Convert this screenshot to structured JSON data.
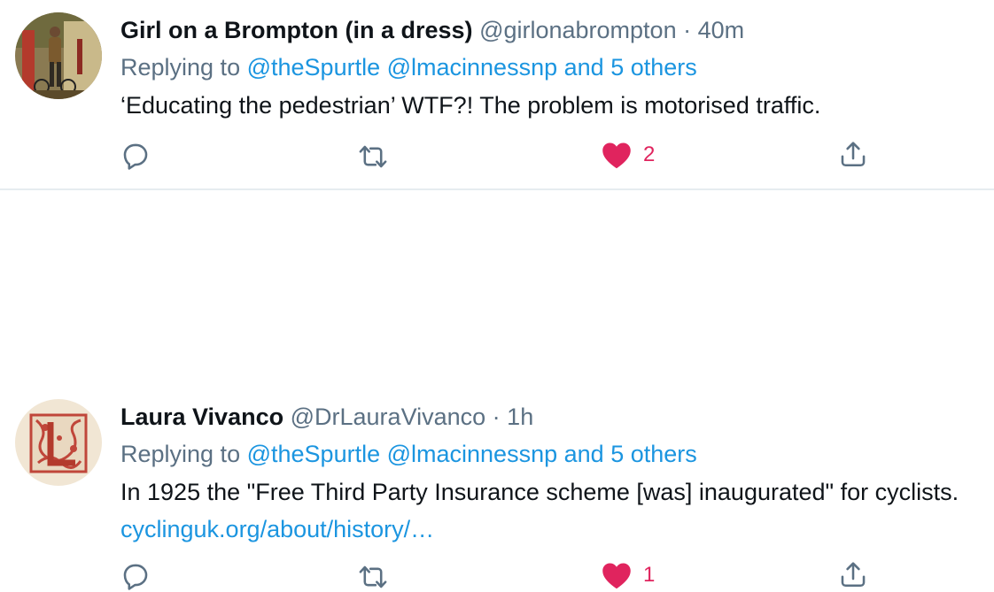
{
  "colors": {
    "text": "#0f1419",
    "secondary": "#5b7083",
    "link": "#1b95e0",
    "like": "#e0245e",
    "divider": "#e6ecf0"
  },
  "tweets": [
    {
      "display_name": "Girl on a Brompton (in a dress)",
      "handle": "@girlonabrompton",
      "separator": "·",
      "time": "40m",
      "replying_prefix": "Replying to",
      "replying_users": "@theSpurtle @lmacinnessnp",
      "replying_and": "and",
      "replying_others": "5 others",
      "text": "‘Educating the pedestrian’ WTF?! The problem is motorised traffic.",
      "link": "",
      "like_count": "2",
      "icons": [
        "reply-icon",
        "retweet-icon",
        "heart-icon",
        "share-icon"
      ]
    },
    {
      "display_name": "Laura Vivanco",
      "handle": "@DrLauraVivanco",
      "separator": "·",
      "time": "1h",
      "replying_prefix": "Replying to",
      "replying_users": "@theSpurtle @lmacinnessnp",
      "replying_and": "and",
      "replying_others": "5 others",
      "text": "In 1925 the \"Free Third Party Insurance scheme [was] inaugurated\" for cyclists.",
      "link": "cyclinguk.org/about/history/…",
      "like_count": "1",
      "icons": [
        "reply-icon",
        "retweet-icon",
        "heart-icon",
        "share-icon"
      ]
    }
  ]
}
